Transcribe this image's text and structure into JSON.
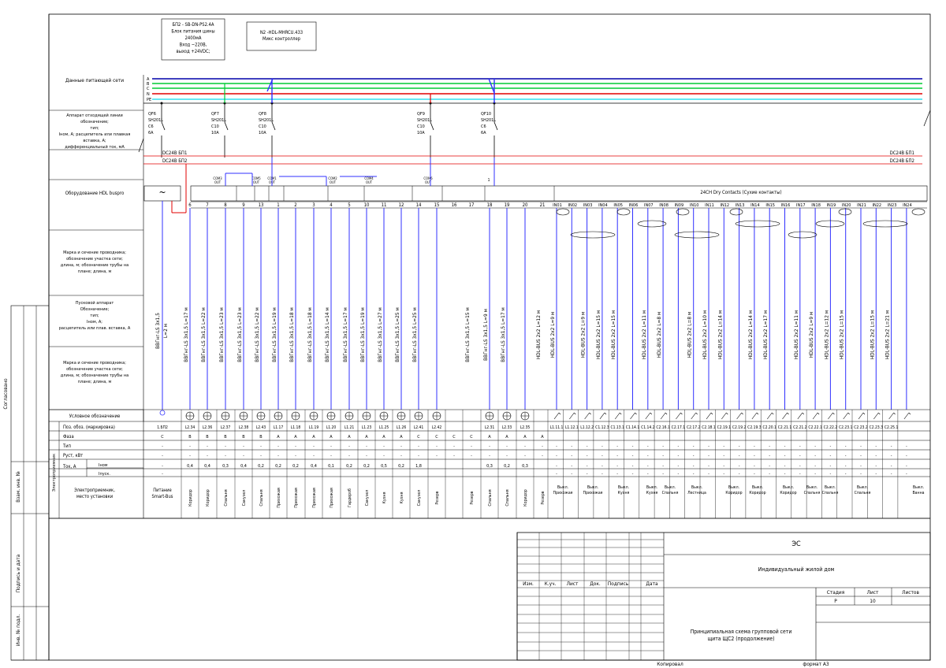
{
  "supply": {
    "label": "Данные питающей сети",
    "phases": [
      "A",
      "B",
      "C",
      "N",
      "PE"
    ]
  },
  "breaker_header": "Аппарат отходящей линии обозначение; тип; Iном, А; расцепитель или плавкая вставка, А; дифференциальный ток, мА",
  "psu_label": "БП2 - SB-DN-PS2.4A Блок питания шины 2400мА Вход ~220В, выход +24VDC;",
  "controller_label": "N2 -HDL-MHRCU.433 Микс контроллер",
  "bus_lines": [
    "DC24В БП1",
    "DC24В БП2"
  ],
  "breakers": [
    {
      "name": "QF6",
      "type": "SH201L",
      "char": "C6",
      "current": "6A"
    },
    {
      "name": "QF7",
      "type": "SH201L",
      "char": "C10",
      "current": "10A"
    },
    {
      "name": "QF8",
      "type": "SH201L",
      "char": "C10",
      "current": "10A"
    },
    {
      "name": "QF9",
      "type": "SH201L",
      "char": "C10",
      "current": "10A"
    },
    {
      "name": "QF10",
      "type": "SH201L",
      "char": "C6",
      "current": "6A"
    }
  ],
  "hdl_row_label": "Оборудование HDL buspro",
  "dry_contacts": "24CH Dry Contacts (Сухие контакты)",
  "com_labels": [
    "COM3 OUT",
    "COM5 OUT",
    "COM1 OUT",
    "COM2 OUT",
    "COM4 OUT",
    "COM6 OUT",
    "1"
  ],
  "channels": [
    "6",
    "7",
    "8",
    "9",
    "13",
    "1",
    "2",
    "3",
    "4",
    "5",
    "10",
    "11",
    "12",
    "14",
    "15",
    "16",
    "17",
    "18",
    "19",
    "20",
    "21"
  ],
  "inputs": [
    "IN01",
    "IN02",
    "IN03",
    "IN04",
    "IN05",
    "IN06",
    "IN07",
    "IN08",
    "IN09",
    "IN10",
    "IN11",
    "IN12",
    "IN13",
    "IN14",
    "IN15",
    "IN16",
    "IN17",
    "IN18",
    "IN19",
    "IN20",
    "IN21",
    "IN22",
    "IN23",
    "IN24"
  ],
  "left_labels": [
    "Марка и сечение проводника; обозначение участка сети; длина, м; обозначение трубы на плане; длина, м",
    "Пусковой аппарат Обозначение; тип; Iном, А; расцепитель или плав. вставка, А",
    "Марка и сечение проводника; обозначение участка сети; длина, м; обозначение трубы на плане; длина, м"
  ],
  "psu_cable": [
    "ВВГнг-LS 3x1,5",
    "L=2 м"
  ],
  "cable_labels": [
    "ВВГнг-LS 3х1,5 L=17 м",
    "ВВГнг-LS 3х1,5 L=22 м",
    "ВВГнг-LS 3х1,5 L=23 м",
    "ВВГнг-LS 3х1,5 L=23 м",
    "ВВГнг-LS 3х1,5 L=22 м",
    "ВВГнг-LS 3х1,5 L=19 м",
    "ВВГнг-LS 3х1,5 L=18 м",
    "ВВГнг-LS 3х1,5 L=18 м",
    "ВВГнг-LS 3х1,5 L=14 м",
    "ВВГнг-LS 3х1,5 L=17 м",
    "ВВГнг-LS 3х1,5 L=19 м",
    "ВВГнг-LS 3х1,5 L=27 м",
    "ВВГнг-LS 3х1,5 L=25 м",
    "ВВГнг-LS 3х1,5 L=25 м",
    "",
    "",
    "ВВГнг-LS 3х1,5 L=15 м",
    "ВВГнг-LS 3х1,5 L=9 м",
    "ВВГнг-LS 3х1,5 L=17 м",
    "",
    "HDL-BUS 2x2 L=12 м",
    "HDL-BUS 2x2 L=9 м",
    "",
    "HDL-BUS 2x2 L=9 м",
    "HDL-BUS 2x2 L=15 м",
    "HDL-BUS 2x2 L=15 м",
    "",
    "HDL-BUS 2x2 L=11 м",
    "HDL-BUS 2x2 L=8 м",
    "",
    "HDL-BUS 2x2 L=8 м",
    "HDL-BUS 2x2 L=10 м",
    "HDL-BUS 2x2 L=14 м",
    "",
    "HDL-BUS 2x2 L=14 м",
    "HDL-BUS 2x2 L=17 м",
    "",
    "HDL-BUS 2x2 L=11 м",
    "HDL-BUS 2x2 L=9 м",
    "HDL-BUS 2x2 L=12 м",
    "HDL-BUS 2x2 L=15 м",
    "",
    "HDL-BUS 2x2 L=15 м",
    "HDL-BUS 2x2 L=21 м"
  ],
  "table_rows": {
    "symbol": "Условное обозначение",
    "pos": "Поз. обоз. (маркировка)",
    "phase": "Фаза",
    "type": "Тип",
    "power": "Руст, кВт",
    "current": "Ток, А",
    "inom": "Iном",
    "ipusk": "Iпуск.",
    "consumer": "Электроприемник, место установки",
    "group": "Электроприемник"
  },
  "pos_values": [
    "1.БП2",
    "L2.34",
    "L2.36",
    "L2.37",
    "L2.38",
    "L2.43",
    "L1.17",
    "L1.18",
    "L1.19",
    "L1.20",
    "L1.21",
    "L1.23",
    "L1.25",
    "L1.26",
    "L2.41",
    "L2.42",
    "",
    "",
    "L2.31",
    "L2.33",
    "L2.35",
    "",
    "L1.11.1",
    "L1.12.1",
    "L1.12.2",
    "C1.12.3",
    "C1.13.1",
    "C1.14.1",
    "C1.14.2",
    "C2.16.1",
    "C2.17.1",
    "C2.17.2",
    "C2.18.1",
    "C2.19.1",
    "C2.19.2",
    "C2.19.3",
    "C2.20.1",
    "C2.21.1",
    "C2.21.2",
    "C2.22.1",
    "C2.22.2",
    "C2.23.1",
    "C2.23.2",
    "C2.23.3",
    "C2.25.1"
  ],
  "phase_values": [
    "С",
    "В",
    "В",
    "В",
    "В",
    "В",
    "А",
    "А",
    "А",
    "А",
    "А",
    "А",
    "А",
    "А",
    "С",
    "С",
    "С",
    "С",
    "А",
    "А",
    "А",
    "А"
  ],
  "inom_values": [
    "-",
    "0,4",
    "0,4",
    "0,3",
    "0,4",
    "0,2",
    "0,2",
    "0,2",
    "0,4",
    "0,1",
    "0,2",
    "0,2",
    "0,5",
    "0,2",
    "1,8",
    "",
    "",
    "",
    "0,3",
    "0,2",
    "0,3"
  ],
  "consumers": [
    "Питание Smart-Bus",
    "Коридор",
    "Коридор",
    "Спальня",
    "Санузел",
    "Спальня",
    "Прихожая",
    "Прихожая",
    "Прихожая",
    "Прихожая",
    "Гардероб",
    "Санузел",
    "Кухня",
    "Кухня",
    "Санузел",
    "Резерв",
    "",
    "Резерв",
    "Спальня",
    "Спальня",
    "Коридор",
    "Резерв"
  ],
  "switch_groups": [
    "Выкл. Прихожая",
    "Выкл. Прихожая",
    "Выкл. Кухня",
    "Выкл. Кухня",
    "Выкл. Спальня",
    "Выкл. Лестница",
    "Выкл. Коридор",
    "Выкл. Коридор",
    "Выкл. Коридор",
    "Выкл. Спальня",
    "Выкл. Спальня",
    "Выкл. Спальня",
    "Выкл. Ванна"
  ],
  "side_stamps": [
    "Согласовано",
    "Взам. инв. №",
    "Подпись и дата",
    "Инв. № подл."
  ],
  "title_block": {
    "code": "ЭС",
    "object": "Индивидуальный жилой дом",
    "headers": [
      "Изм.",
      "К.уч.",
      "Лист",
      "Док.",
      "Подпись",
      "Дата"
    ],
    "stage_h": "Стадия",
    "sheet_h": "Лист",
    "sheets_h": "Листов",
    "stage": "Р",
    "sheet": "10",
    "title": "Принципиальная схема групповой сети щита ЩС2 (продолжение)",
    "copied": "Копировал",
    "format": "формат А3"
  }
}
